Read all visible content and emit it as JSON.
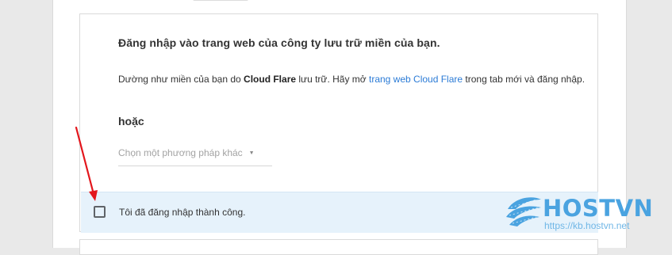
{
  "section": {
    "heading": "Đăng nhập vào trang web của công ty lưu trữ miền của bạn.",
    "desc_prefix": "Dường như miền của bạn do ",
    "provider": "Cloud Flare",
    "desc_middle": " lưu trữ. Hãy mở ",
    "provider_link": "trang web Cloud Flare",
    "desc_suffix": " trong tab mới và đăng nhập.",
    "or_label": "hoặc",
    "method_select": {
      "selected": "Chọn một phương pháp khác",
      "arrow": "▼"
    },
    "confirm": {
      "label": "Tôi đã đăng nhập thành công.",
      "checked": false
    }
  },
  "watermark": {
    "brand": "HOSTVN",
    "url": "https://kb.hostvn.net"
  },
  "colors": {
    "link": "#2b7bd6",
    "confirm_bg": "#e6f2fb",
    "annotation_arrow": "#e3161c",
    "brand": "#4aa3e0"
  }
}
